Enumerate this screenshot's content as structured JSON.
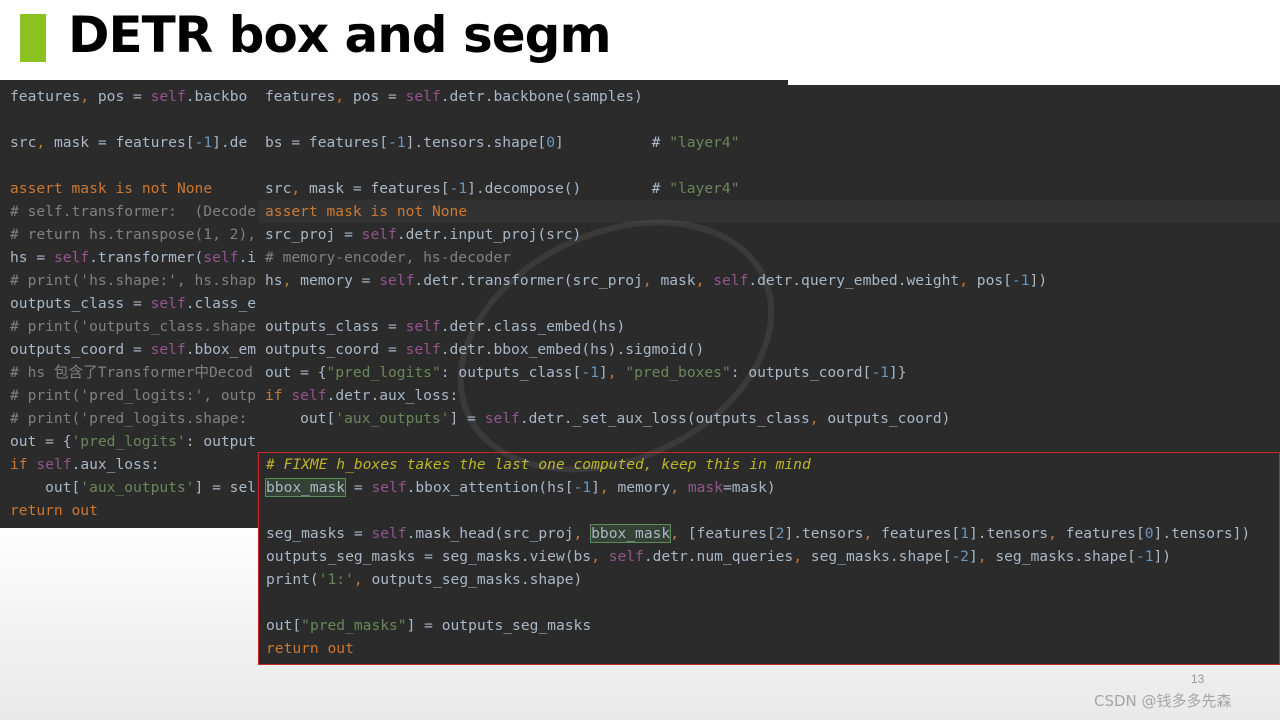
{
  "slide": {
    "title": "DETR box and segm",
    "page_number": "13",
    "footer": "CSDN @钱多多先森",
    "accent_color": "#8cc220"
  },
  "back_code": {
    "lines": [
      "features, pos = self.backbo",
      "",
      "src, mask = features[-1].de",
      "",
      "assert mask is not None",
      "# self.transformer:  (Decode",
      "# return hs.transpose(1, 2),",
      "hs = self.transformer(self.i",
      "# print('hs.shape:', hs.shap",
      "outputs_class = self.class_e",
      "# print('outputs_class.shape",
      "outputs_coord = self.bbox_em",
      "# hs 包含了Transformer中Decod",
      "# print('pred_logits:', outp",
      "# print('pred_logits.shape: ",
      "out = {'pred_logits': output",
      "if self.aux_loss:",
      "    out['aux_outputs'] = sel",
      "return out"
    ]
  },
  "front_code": {
    "lines": [
      "features, pos = self.detr.backbone(samples)",
      "",
      "bs = features[-1].tensors.shape[0]          # \"layer4\"",
      "",
      "src, mask = features[-1].decompose()        # \"layer4\"",
      "assert mask is not None",
      "src_proj = self.detr.input_proj(src)",
      "# memory-encoder, hs-decoder",
      "hs, memory = self.detr.transformer(src_proj, mask, self.detr.query_embed.weight, pos[-1])",
      "",
      "outputs_class = self.detr.class_embed(hs)",
      "outputs_coord = self.detr.bbox_embed(hs).sigmoid()",
      "out = {\"pred_logits\": outputs_class[-1], \"pred_boxes\": outputs_coord[-1]}",
      "if self.detr.aux_loss:",
      "    out['aux_outputs'] = self.detr._set_aux_loss(outputs_class, outputs_coord)"
    ]
  },
  "highlight_code": {
    "border_color": "#c62828",
    "lines": [
      "# FIXME h_boxes takes the last one computed, keep this in mind",
      "bbox_mask = self.bbox_attention(hs[-1], memory, mask=mask)",
      "",
      "seg_masks = self.mask_head(src_proj, bbox_mask, [features[2].tensors, features[1].tensors, features[0].tensors])",
      "outputs_seg_masks = seg_masks.view(bs, self.detr.num_queries, seg_masks.shape[-2], seg_masks.shape[-1])",
      "print('1:', outputs_seg_masks.shape)",
      "",
      "out[\"pred_masks\"] = outputs_seg_masks",
      "return out"
    ]
  }
}
